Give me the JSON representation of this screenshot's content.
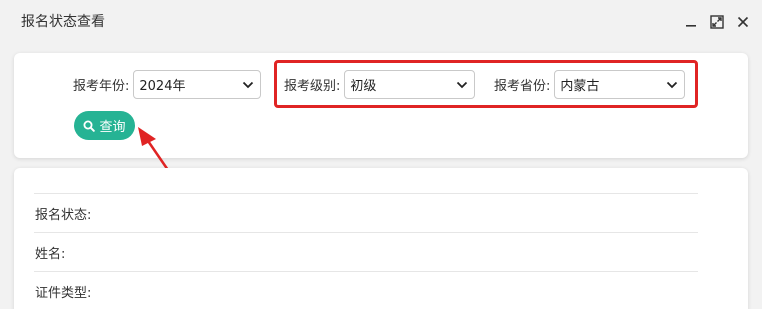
{
  "window": {
    "title": "报名状态查看",
    "controls": [
      "minimize-icon",
      "maximize-icon",
      "close-icon"
    ]
  },
  "filters": {
    "year": {
      "label": "报考年份:",
      "value": "2024年"
    },
    "level": {
      "label": "报考级别:",
      "value": "初级"
    },
    "province": {
      "label": "报考省份:",
      "value": "内蒙古"
    }
  },
  "query_button": {
    "label": "查询",
    "icon": "search-icon",
    "color": "#26b394"
  },
  "annotation": {
    "highlight_color": "#e02424",
    "arrow_color": "#e02424"
  },
  "details": {
    "rows": [
      {
        "label": "报名状态:"
      },
      {
        "label": "姓名:"
      },
      {
        "label": "证件类型:"
      }
    ]
  }
}
